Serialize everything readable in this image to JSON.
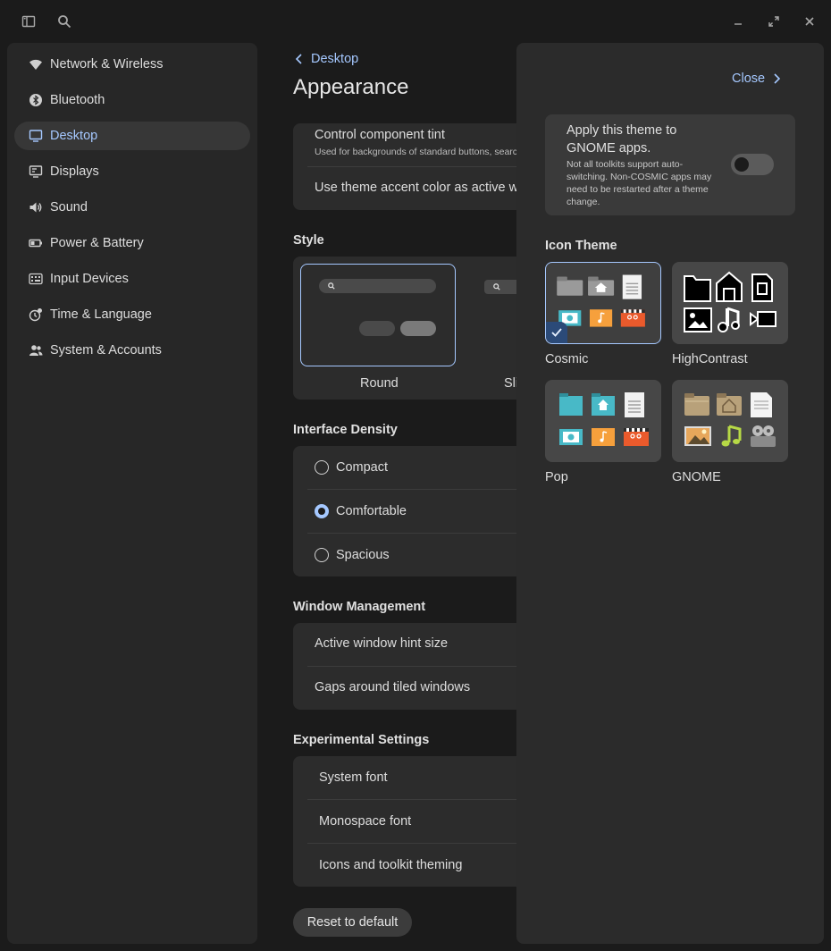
{
  "header": {
    "sidebar_toggle_icon": "sidebar-icon",
    "search_icon": "search-icon",
    "minimize_icon": "minimize-icon",
    "maximize_icon": "maximize-icon",
    "close_icon": "close-icon"
  },
  "sidebar": {
    "items": [
      {
        "label": "Network & Wireless",
        "icon": "wifi-icon"
      },
      {
        "label": "Bluetooth",
        "icon": "bluetooth-icon"
      },
      {
        "label": "Desktop",
        "icon": "desktop-icon",
        "active": true
      },
      {
        "label": "Displays",
        "icon": "display-icon"
      },
      {
        "label": "Sound",
        "icon": "speaker-icon"
      },
      {
        "label": "Power & Battery",
        "icon": "battery-icon"
      },
      {
        "label": "Input Devices",
        "icon": "keyboard-icon"
      },
      {
        "label": "Time & Language",
        "icon": "clock-icon"
      },
      {
        "label": "System & Accounts",
        "icon": "users-icon"
      }
    ]
  },
  "main": {
    "back_label": "Desktop",
    "title": "Appearance",
    "tint": {
      "title": "Control component tint",
      "subtitle": "Used for backgrounds of standard buttons, search",
      "accent_row": "Use theme accent color as active wi"
    },
    "style": {
      "title": "Style",
      "options": [
        "Round",
        "Sli"
      ]
    },
    "density": {
      "title": "Interface Density",
      "options": [
        "Compact",
        "Comfortable",
        "Spacious"
      ],
      "selected": "Comfortable"
    },
    "window_management": {
      "title": "Window Management",
      "rows": [
        "Active window hint size",
        "Gaps around tiled windows"
      ]
    },
    "experimental": {
      "title": "Experimental Settings",
      "rows": [
        "System font",
        "Monospace font",
        "Icons and toolkit theming"
      ]
    },
    "reset_label": "Reset to default"
  },
  "panel": {
    "close_label": "Close",
    "gnome": {
      "title": "Apply this theme to GNOME apps.",
      "description": "Not all toolkits support auto-switching. Non-COSMIC apps may need to be restarted after a theme change.",
      "enabled": false
    },
    "icon_theme": {
      "title": "Icon Theme",
      "themes": [
        "Cosmic",
        "HighContrast",
        "Pop",
        "GNOME"
      ],
      "selected": "Cosmic"
    }
  },
  "colors": {
    "accent": "#a5c8ff",
    "window_bg": "#1b1b1b",
    "card_bg": "#2c2c2c",
    "panel_bg": "#2b2b2b",
    "orange": "#f6a03c",
    "red": "#ea5a2c",
    "teal": "#48b9c7"
  }
}
